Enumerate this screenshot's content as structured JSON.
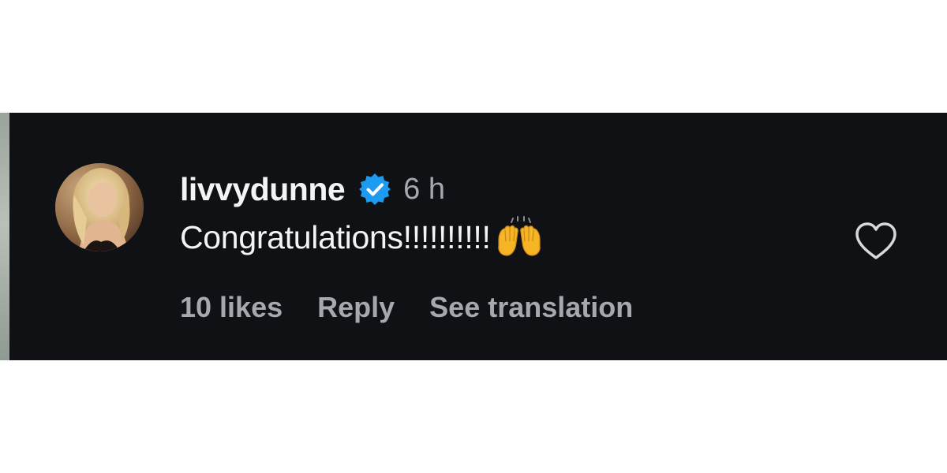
{
  "comment": {
    "username": "livvydunne",
    "timestamp": "6 h",
    "text": "Congratulations!!!!!!!!!!",
    "emoji": "raising-hands",
    "likes_label": "10 likes",
    "reply_label": "Reply",
    "translate_label": "See translation"
  },
  "icons": {
    "verified": "verified-badge-icon",
    "like": "heart-outline-icon"
  },
  "colors": {
    "background": "#0f1115",
    "primary_text": "#f3f4f6",
    "secondary_text": "#a6a8ad",
    "verified": "#1d9bf0",
    "emoji": "#f5b524"
  }
}
